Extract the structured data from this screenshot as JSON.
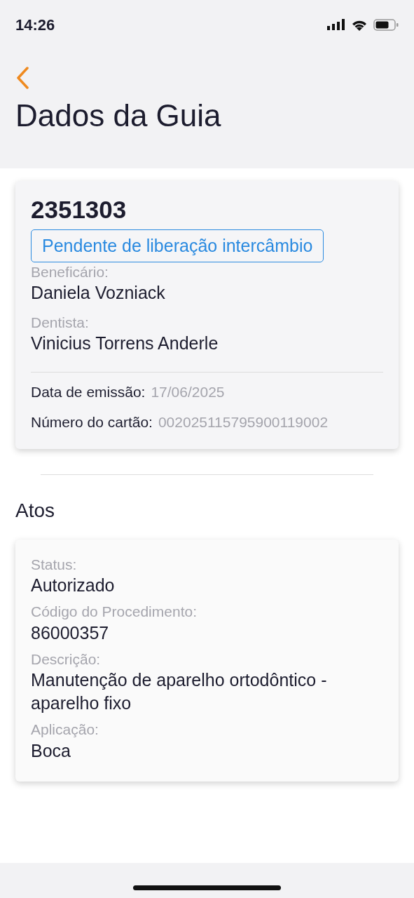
{
  "status_bar": {
    "time": "14:26"
  },
  "header": {
    "title": "Dados da Guia"
  },
  "guia": {
    "number": "2351303",
    "badge": "Pendente de liberação intercâmbio",
    "fields": [
      {
        "label": "Beneficário:",
        "value": "Daniela Vozniack"
      },
      {
        "label": "Dentista:",
        "value": "Vinicius Torrens Anderle"
      }
    ],
    "details": [
      {
        "label": "Data de emissão:",
        "value": "17/06/2025"
      },
      {
        "label": "Número do cartão:",
        "value": "002025115795900119002"
      }
    ]
  },
  "atos": {
    "title": "Atos",
    "fields": [
      {
        "label": "Status:",
        "value": "Autorizado"
      },
      {
        "label": "Código do Procedimento:",
        "value": "86000357"
      },
      {
        "label": "Descrição:",
        "value": "Manutenção de aparelho ortodôntico - aparelho fixo"
      },
      {
        "label": "Aplicação:",
        "value": "Boca"
      }
    ]
  }
}
